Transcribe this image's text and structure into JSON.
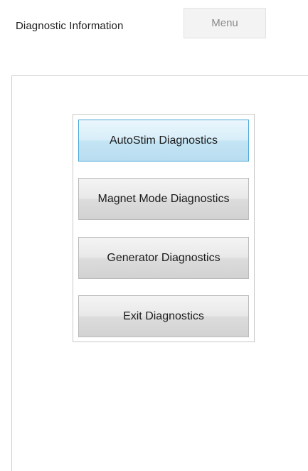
{
  "header": {
    "title": "Diagnostic Information",
    "menu_label": "Menu"
  },
  "diagnostics": {
    "buttons": [
      {
        "label": "AutoStim Diagnostics",
        "state": "highlighted"
      },
      {
        "label": "Magnet Mode Diagnostics",
        "state": "normal"
      },
      {
        "label": "Generator Diagnostics",
        "state": "normal"
      },
      {
        "label": "Exit Diagnostics",
        "state": "normal"
      }
    ]
  },
  "colors": {
    "highlight_border": "#4aa7d8",
    "highlight_fill": "#c3e4f4",
    "button_fill": "#dcdcdc"
  }
}
